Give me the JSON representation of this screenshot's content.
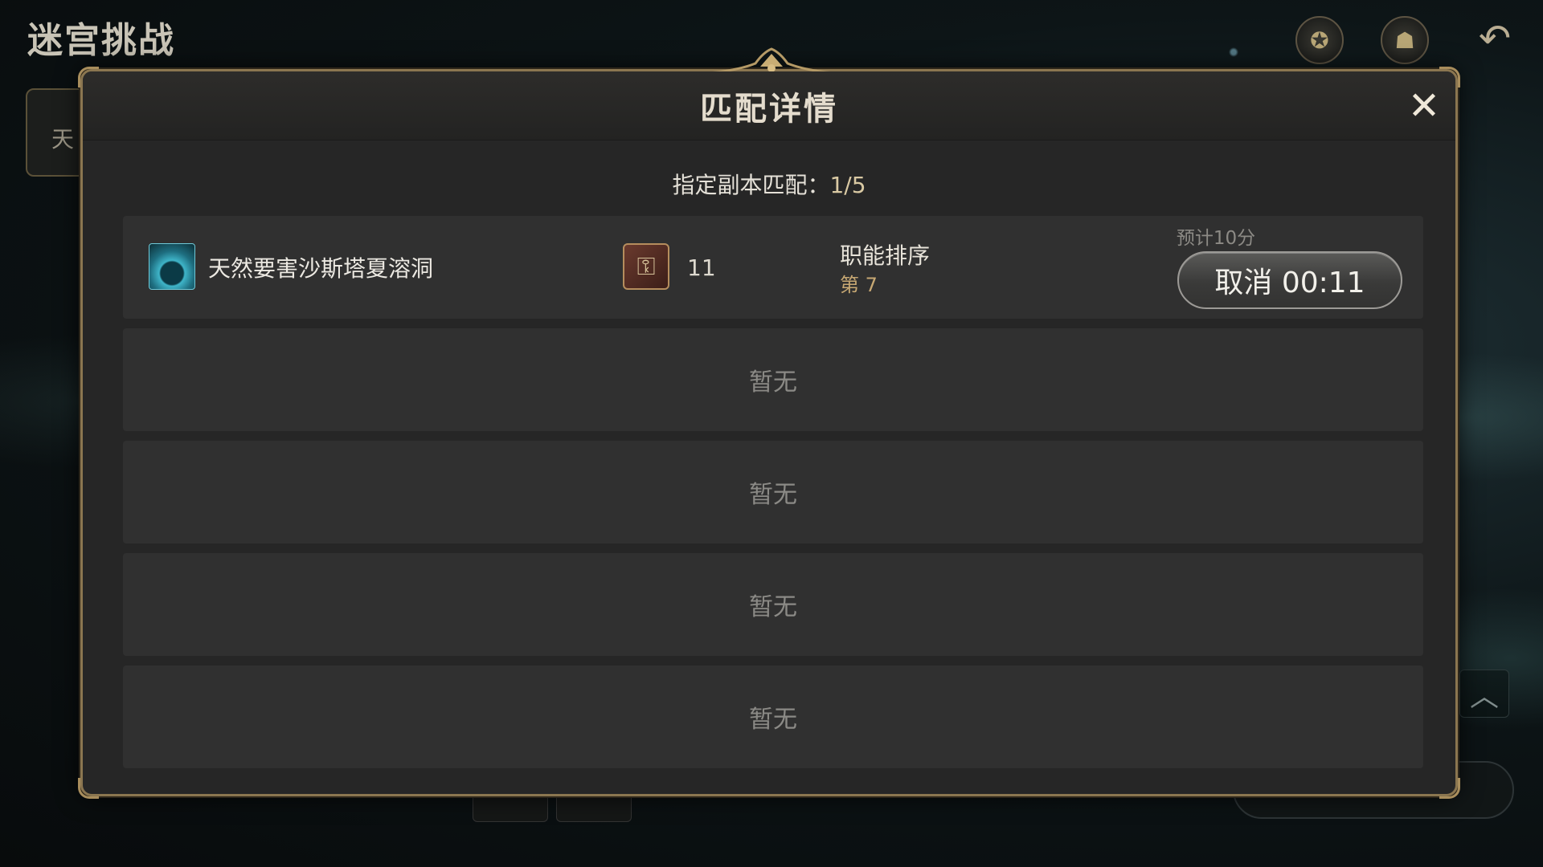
{
  "background": {
    "title": "迷宫挑战",
    "side_tab_label": "天",
    "icons": [
      "emblem-icon",
      "team-icon",
      "back-icon"
    ]
  },
  "modal": {
    "title": "匹配详情",
    "match_label": "指定副本匹配：",
    "match_count": "1/5",
    "active_entry": {
      "dungeon_name": "天然要害沙斯塔夏溶洞",
      "key_count": "11",
      "role_label": "职能排序",
      "role_rank": "第 7",
      "estimate": "预计10分",
      "cancel_label": "取消 00:11"
    },
    "empty_rows": [
      {
        "label": "暂无"
      },
      {
        "label": "暂无"
      },
      {
        "label": "暂无"
      },
      {
        "label": "暂无"
      }
    ]
  },
  "colors": {
    "gold_border": "#8b7650",
    "panel": "#262626",
    "row": "#303030",
    "rank_text": "#c7a873"
  }
}
